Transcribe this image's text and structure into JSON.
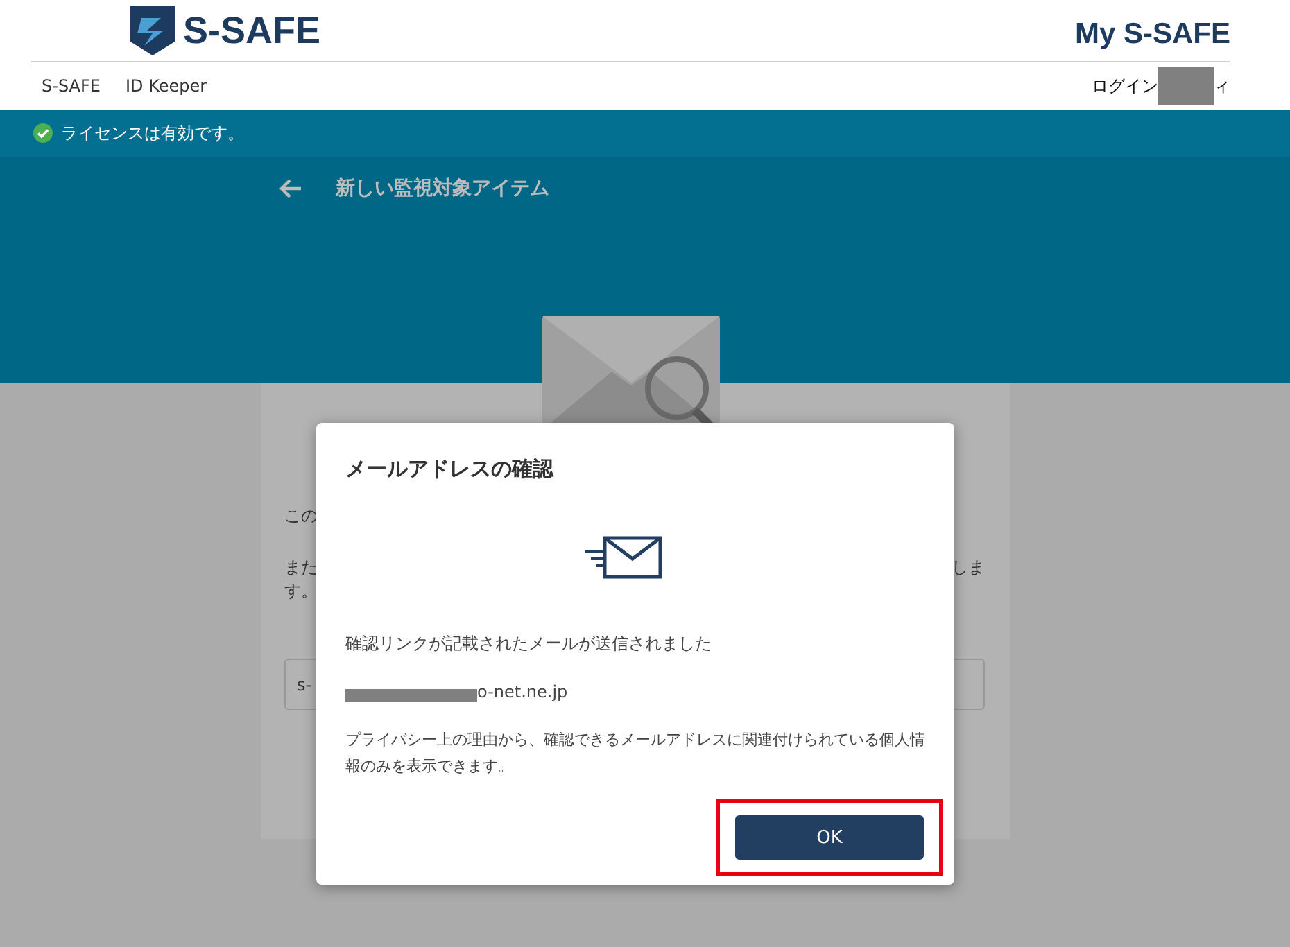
{
  "header": {
    "logo": "S-SAFE",
    "title": "My S-SAFE"
  },
  "nav": {
    "items": [
      {
        "label": "S-SAFE"
      },
      {
        "label": "ID Keeper"
      }
    ],
    "login_label": "ログイン",
    "login_tail": "ィ"
  },
  "license_banner": {
    "text": "ライセンスは有効です。"
  },
  "page": {
    "title": "新しい監視対象アイテム",
    "line_1": "この",
    "line_2": "また",
    "line_2_end": "しま",
    "line_3": "す。",
    "field_value": "s-"
  },
  "dialog": {
    "title": "メールアドレスの確認",
    "message": "確認リンクが記載されたメールが送信されました",
    "email": "o-net.ne.jp",
    "note": "プライバシー上の理由から、確認できるメールアドレスに関連付けられている個人情報のみを表示できます。",
    "ok_button": "OK",
    "ok_highlighted": true
  }
}
